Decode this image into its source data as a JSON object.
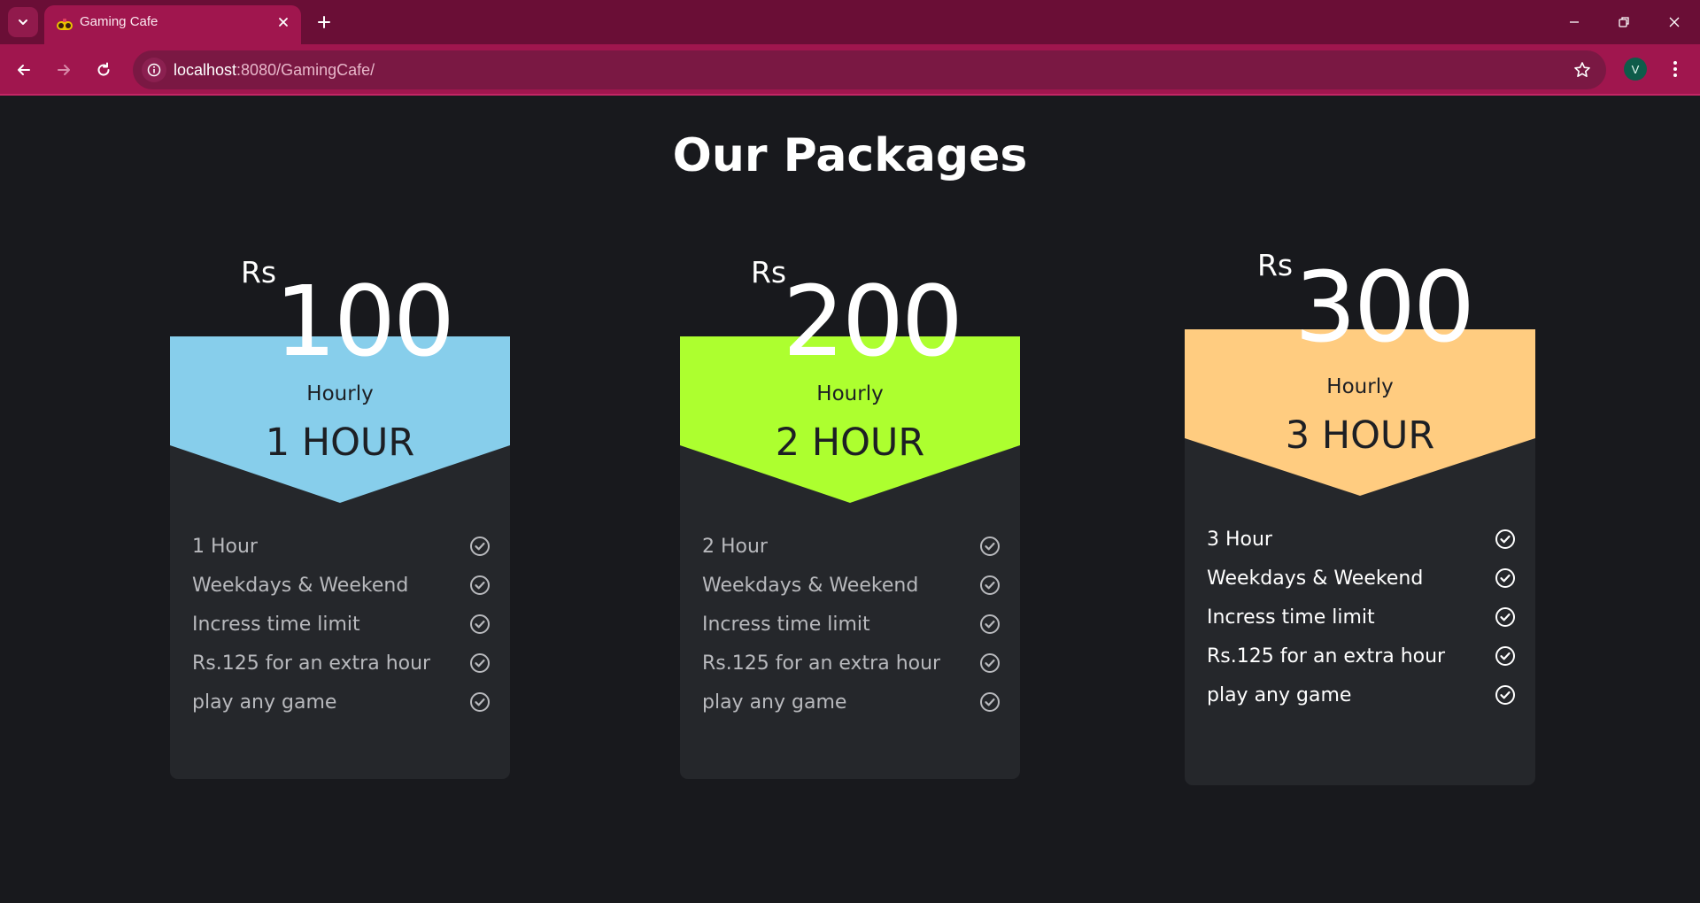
{
  "browser": {
    "tab_title": "Gaming Cafe",
    "url_host": "localhost",
    "url_rest": ":8080/GamingCafe/",
    "profile_initial": "V",
    "accent": "#a0164e"
  },
  "page": {
    "title": "Our Packages",
    "background": "#18191d"
  },
  "packages": [
    {
      "currency": "Rs",
      "price": "100",
      "period": "Hourly",
      "duration": "1 HOUR",
      "color": "#87ceeb",
      "features": [
        "1 Hour",
        "Weekdays & Weekend",
        "Incress time limit",
        "Rs.125 for an extra hour",
        "play any game"
      ]
    },
    {
      "currency": "Rs",
      "price": "200",
      "period": "Hourly",
      "duration": "2 HOUR",
      "color": "#adff2f",
      "features": [
        "2 Hour",
        "Weekdays & Weekend",
        "Incress time limit",
        "Rs.125 for an extra hour",
        "play any game"
      ]
    },
    {
      "currency": "Rs",
      "price": "300",
      "period": "Hourly",
      "duration": "3 HOUR",
      "color": "#ffcc80",
      "features": [
        "3 Hour",
        "Weekdays & Weekend",
        "Incress time limit",
        "Rs.125 for an extra hour",
        "play any game"
      ]
    }
  ]
}
